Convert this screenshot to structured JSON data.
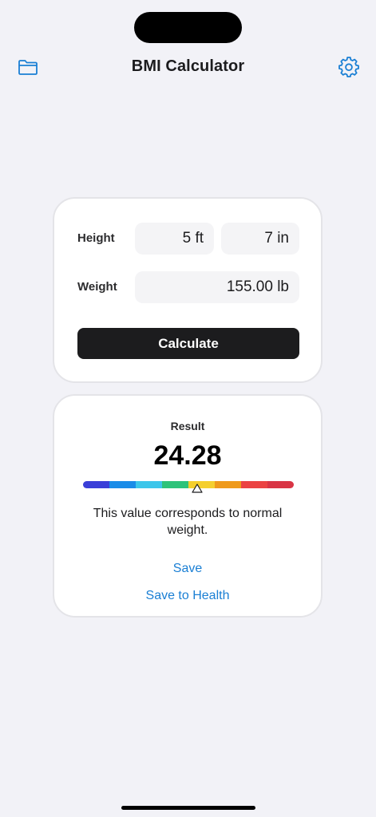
{
  "nav": {
    "title": "BMI Calculator",
    "left_icon": "folder-icon",
    "right_icon": "gear-icon",
    "accent": "#1a7fd4"
  },
  "inputs": {
    "height_label": "Height",
    "height_feet": "5 ft",
    "height_inches": "7 in",
    "weight_label": "Weight",
    "weight_value": "155.00 lb",
    "calculate_label": "Calculate"
  },
  "result": {
    "label": "Result",
    "value": "24.28",
    "description": "This value corresponds to normal weight.",
    "scale_colors": [
      "#3a3fd8",
      "#1a8ce8",
      "#3cc6ea",
      "#2ec37a",
      "#f5cf2e",
      "#ef9a1b",
      "#eb4343",
      "#d93545"
    ],
    "marker_fraction": 0.54,
    "save_label": "Save",
    "save_health_label": "Save to Health"
  }
}
